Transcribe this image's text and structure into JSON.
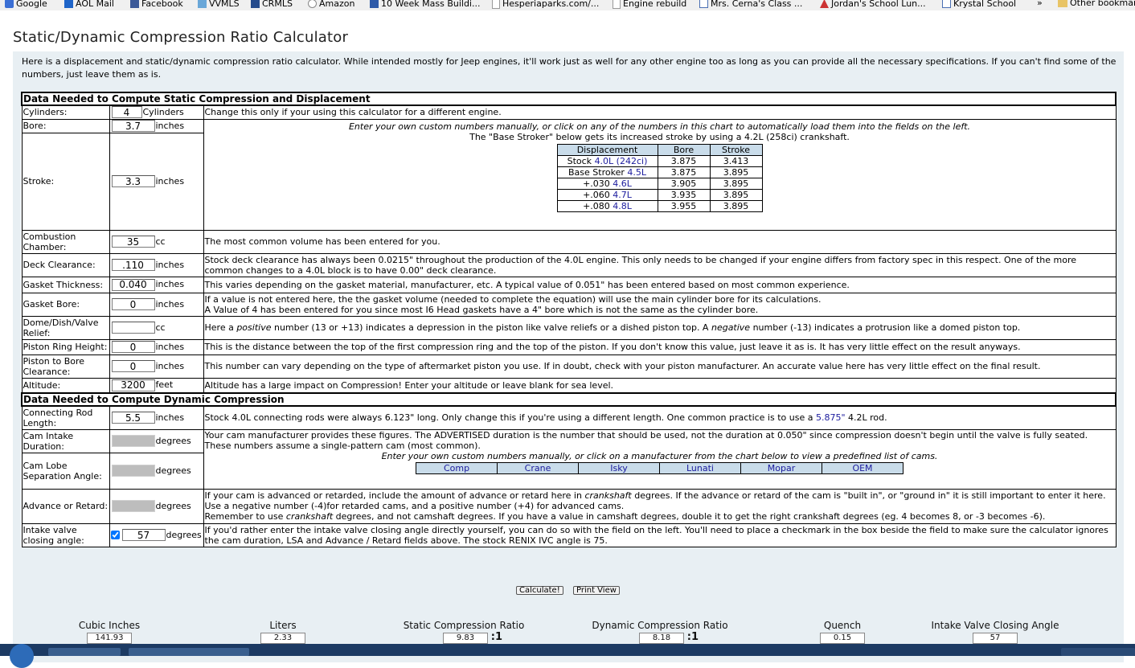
{
  "bookmarks": [
    {
      "label": "Google",
      "icon": "google-icon"
    },
    {
      "label": "AOL Mail",
      "icon": "aol-icon"
    },
    {
      "label": "Facebook",
      "icon": "facebook-icon"
    },
    {
      "label": "VVMLS",
      "icon": "vvmls-icon"
    },
    {
      "label": "CRMLS",
      "icon": "crmls-icon"
    },
    {
      "label": "Amazon",
      "icon": "amazon-icon"
    },
    {
      "label": "10 Week Mass Buildi...",
      "icon": "mass-icon"
    },
    {
      "label": "Hesperiaparks.com/...",
      "icon": "parks-icon"
    },
    {
      "label": "Engine rebuild",
      "icon": "page-icon"
    },
    {
      "label": "Mrs. Cerna's Class ...",
      "icon": "school-icon"
    },
    {
      "label": "Jordan's School Lun...",
      "icon": "lunch-icon"
    },
    {
      "label": "Krystal School",
      "icon": "school-icon"
    },
    {
      "label": "»",
      "icon": ""
    },
    {
      "label": "Other bookmarks",
      "icon": "folder-icon"
    }
  ],
  "page": {
    "title": "Static/Dynamic Compression Ratio Calculator",
    "intro": "Here is a displacement and static/dynamic compression ratio calculator. While intended mostly for Jeep engines, it'll work just as well for any other engine too as long as you can provide all the necessary specifications. If you can't find some of the numbers, just leave them as is."
  },
  "static_section": "Data Needed to Compute Static Compression and Displacement",
  "dynamic_section": "Data Needed to Compute Dynamic Compression",
  "fields": {
    "cylinders": {
      "label": "Cylinders:",
      "value": "4",
      "unit": "Cylinders",
      "desc": "Change this only if your using this calculator for a different engine."
    },
    "bore": {
      "label": "Bore:",
      "value": "3.7",
      "unit": "inches"
    },
    "stroke": {
      "label": "Stroke:",
      "value": "3.3",
      "unit": "inches"
    },
    "combustion": {
      "label": "Combustion Chamber:",
      "value": "35",
      "unit": "cc",
      "desc": "The most common volume has been entered for you."
    },
    "deck": {
      "label": "Deck Clearance:",
      "value": ".110",
      "unit": "inches",
      "desc": "Stock deck clearance has always been 0.0215\" throughout the production of the 4.0L engine. This only needs to be changed if your engine differs from factory spec in this respect. One of the more common changes to a 4.0L block is to have 0.00\" deck clearance."
    },
    "gasket_thickness": {
      "label": "Gasket Thickness:",
      "value": "0.040",
      "unit": "inches",
      "desc": "This varies depending on the gasket material, manufacturer, etc. A typical value of 0.051\" has been entered based on most common experience."
    },
    "gasket_bore": {
      "label": "Gasket Bore:",
      "value": "0",
      "unit": "inches",
      "desc1": "If a value is not entered here, the the gasket volume (needed to complete the equation) will use the main cylinder bore for its calculations.",
      "desc2": "A Value of 4 has been entered for you since most I6 Head gaskets have a 4\" bore which is not the same as the cylinder bore."
    },
    "dome": {
      "label": "Dome/Dish/Valve Relief:",
      "value": "",
      "unit": "cc",
      "desc_a": "Here a ",
      "desc_pos": "positive",
      "desc_b": " number (13 or +13) indicates a depression in the piston like valve reliefs or a dished piston top. A ",
      "desc_neg": "negative",
      "desc_c": " number (-13) indicates a protrusion like a domed piston top."
    },
    "ring_height": {
      "label": "Piston Ring Height:",
      "value": "0",
      "unit": "inches",
      "desc": "This is the distance between the top of the first compression ring and the top of the piston.  If you don't know this value, just leave it as is. It has very little effect on the result anyways."
    },
    "piston_bore": {
      "label": "Piston to Bore Clearance:",
      "value": "0",
      "unit": "inches",
      "desc": "This number can vary depending on the type of aftermarket piston you use. If in doubt, check with your piston manufacturer. An accurate value here has very little effect on the final result."
    },
    "altitude": {
      "label": "Altitude:",
      "value": "3200",
      "unit": "feet",
      "desc": "Altitude has a large impact on Compression! Enter your altitude or leave blank for sea level."
    },
    "rod": {
      "label": "Connecting Rod Length:",
      "value": "5.5",
      "unit": "inches",
      "desc_a": "Stock 4.0L connecting rods were always 6.123\" long. Only change this if you're using a different length. One common practice is to use a ",
      "desc_link": "5.875\"",
      "desc_b": " 4.2L rod."
    },
    "cam_intake": {
      "label": "Cam Intake Duration:",
      "value": "",
      "unit": "degrees",
      "desc1": "Your cam manufacturer provides these figures. The ADVERTISED duration is the number that should be used, not the duration at 0.050\" since compression doesn't begin until the valve is fully seated.",
      "desc2": "These numbers assume a single-pattern cam (most common).",
      "desc3": "Enter your own custom numbers manually, or click on a manufacturer from the chart below to view a predefined list of cams."
    },
    "lsa": {
      "label": "Cam Lobe Separation Angle:",
      "value": "",
      "unit": "degrees"
    },
    "advance": {
      "label": "Advance or Retard:",
      "value": "",
      "unit": "degrees",
      "desc_a": "If your cam is advanced or retarded, include the amount of advance or retard here in ",
      "desc_i1": "crankshaft",
      "desc_b": " degrees. If the advance or retard of the cam is \"built in\", or \"ground in\" it is still important to enter it here. Use a negative number (-4)for retarded cams, and a positive number (+4) for advanced cams.",
      "desc_c": "Remember to use ",
      "desc_i2": "crankshaft",
      "desc_d": " degrees, and not camshaft degrees. If you have a value in camshaft degrees, double it to get the right crankshaft degrees (eg. 4 becomes 8, or -3 becomes -6)."
    },
    "ivc": {
      "label": "Intake valve closing angle:",
      "value": "57",
      "unit": "degrees",
      "checked": true,
      "desc": "If you'd rather enter the intake valve closing angle directly yourself, you can do so with the field on the left. You'll need to place a checkmark in the box beside the field to make sure the calculator ignores the cam duration, LSA and Advance / Retard fields above. The stock RENIX IVC angle is 75."
    }
  },
  "stroker": {
    "note": "Enter your own custom numbers manually, or click on any of the numbers in this chart to automatically load them into the fields on the left.",
    "note2": "The \"Base Stroker\" below gets its increased stroke by using a 4.2L (258ci) crankshaft.",
    "headers": [
      "Displacement",
      "Bore",
      "Stroke"
    ],
    "rows": [
      {
        "prefix": "Stock ",
        "link": "4.0L (242ci)",
        "bore": "3.875",
        "stroke": "3.413"
      },
      {
        "prefix": "Base Stroker ",
        "link": "4.5L",
        "bore": "3.875",
        "stroke": "3.895"
      },
      {
        "prefix": "+.030 ",
        "link": "4.6L",
        "bore": "3.905",
        "stroke": "3.895"
      },
      {
        "prefix": "+.060 ",
        "link": "4.7L",
        "bore": "3.935",
        "stroke": "3.895"
      },
      {
        "prefix": "+.080 ",
        "link": "4.8L",
        "bore": "3.955",
        "stroke": "3.895"
      }
    ]
  },
  "manufacturers": [
    "Comp",
    "Crane",
    "Isky",
    "Lunati",
    "Mopar",
    "OEM"
  ],
  "buttons": {
    "calculate": "Calculate!",
    "print": "Print View"
  },
  "results": [
    {
      "label": "Cubic Inches",
      "value": "141.93",
      "suffix": ""
    },
    {
      "label": "Liters",
      "value": "2.33",
      "suffix": ""
    },
    {
      "label": "Static Compression Ratio",
      "value": "9.83",
      "suffix": ":1"
    },
    {
      "label": "Dynamic Compression Ratio",
      "value": "8.18",
      "suffix": ":1"
    },
    {
      "label": "Quench",
      "value": "0.15",
      "suffix": ""
    },
    {
      "label": "Intake Valve Closing Angle",
      "value": "57",
      "suffix": ""
    }
  ]
}
